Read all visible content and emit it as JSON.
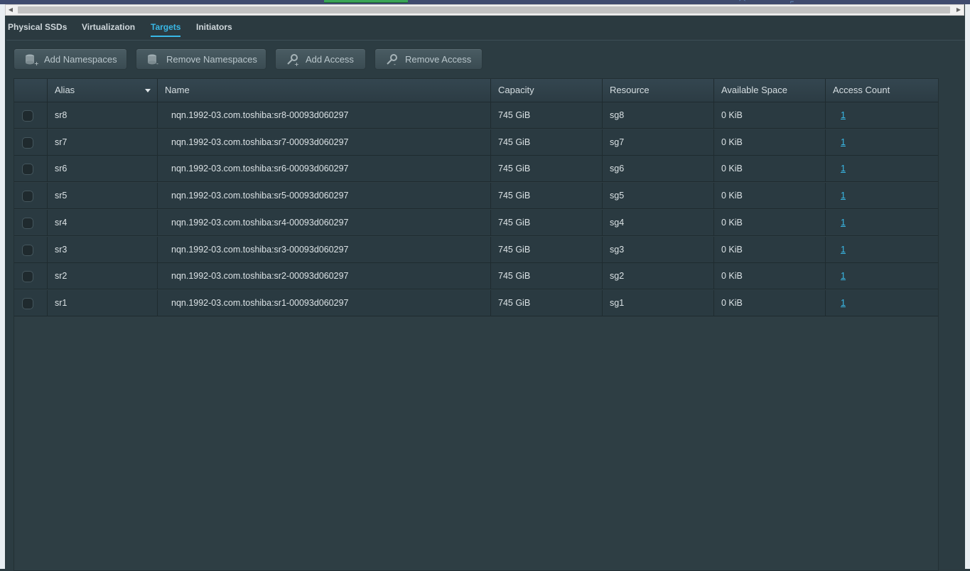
{
  "tabs": [
    {
      "label": "Physical SSDs",
      "active": false
    },
    {
      "label": "Virtualization",
      "active": false
    },
    {
      "label": "Targets",
      "active": true
    },
    {
      "label": "Initiators",
      "active": false
    }
  ],
  "toolbar": {
    "add_namespaces": "Add Namespaces",
    "remove_namespaces": "Remove Namespaces",
    "add_access": "Add Access",
    "remove_access": "Remove Access"
  },
  "table": {
    "columns": [
      "Alias",
      "Name",
      "Capacity",
      "Resource",
      "Available Space",
      "Access Count"
    ],
    "sorted_column": "Alias",
    "rows": [
      {
        "alias": "sr8",
        "name": "nqn.1992-03.com.toshiba:sr8-00093d060297",
        "capacity": "745 GiB",
        "resource": "sg8",
        "available": "0 KiB",
        "access_count": "1"
      },
      {
        "alias": "sr7",
        "name": "nqn.1992-03.com.toshiba:sr7-00093d060297",
        "capacity": "745 GiB",
        "resource": "sg7",
        "available": "0 KiB",
        "access_count": "1"
      },
      {
        "alias": "sr6",
        "name": "nqn.1992-03.com.toshiba:sr6-00093d060297",
        "capacity": "745 GiB",
        "resource": "sg6",
        "available": "0 KiB",
        "access_count": "1"
      },
      {
        "alias": "sr5",
        "name": "nqn.1992-03.com.toshiba:sr5-00093d060297",
        "capacity": "745 GiB",
        "resource": "sg5",
        "available": "0 KiB",
        "access_count": "1"
      },
      {
        "alias": "sr4",
        "name": "nqn.1992-03.com.toshiba:sr4-00093d060297",
        "capacity": "745 GiB",
        "resource": "sg4",
        "available": "0 KiB",
        "access_count": "1"
      },
      {
        "alias": "sr3",
        "name": "nqn.1992-03.com.toshiba:sr3-00093d060297",
        "capacity": "745 GiB",
        "resource": "sg3",
        "available": "0 KiB",
        "access_count": "1"
      },
      {
        "alias": "sr2",
        "name": "nqn.1992-03.com.toshiba:sr2-00093d060297",
        "capacity": "745 GiB",
        "resource": "sg2",
        "available": "0 KiB",
        "access_count": "1"
      },
      {
        "alias": "sr1",
        "name": "nqn.1992-03.com.toshiba:sr1-00093d060297",
        "capacity": "745 GiB",
        "resource": "sg1",
        "available": "0 KiB",
        "access_count": "1"
      }
    ]
  },
  "colors": {
    "accent": "#39b8e6",
    "background": "#2b3a40",
    "row": "#2a3a41"
  },
  "icons": {
    "add_namespaces": "database-add-icon",
    "remove_namespaces": "database-remove-icon",
    "add_access": "key-add-icon",
    "remove_access": "key-remove-icon",
    "sort": "sort-down-icon"
  }
}
